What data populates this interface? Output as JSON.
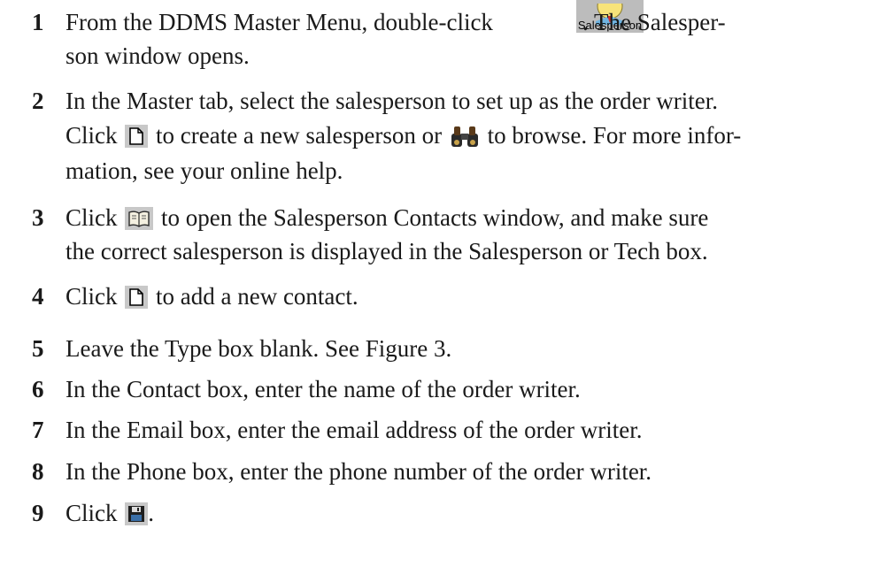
{
  "steps": [
    {
      "number": "1",
      "line1a": "From the DDMS Master Menu, double-click",
      "icon_label": "Salesperson",
      "line1b": ". The Salesper-",
      "line2": "son window opens."
    },
    {
      "number": "2",
      "line1": "In the Master tab, select the salesperson to set up as the order writer.",
      "line2a": "Click",
      "line2b": "to create a new salesperson or",
      "line2c": "to browse. For more infor-",
      "line3": "mation, see your online help."
    },
    {
      "number": "3",
      "line1a": "Click",
      "line1b": "to open the Salesperson Contacts window, and make sure",
      "line2": "the correct salesperson is displayed in the Salesperson or Tech box."
    },
    {
      "number": "4",
      "line1a": "Click",
      "line1b": "to add a new contact."
    },
    {
      "number": "5",
      "text": "Leave the Type box blank. See Figure 3."
    },
    {
      "number": "6",
      "text": "In the Contact box, enter the name of the order writer."
    },
    {
      "number": "7",
      "text": "In the Email box, enter the email address of the order writer."
    },
    {
      "number": "8",
      "text": "In the Phone box, enter the phone number of the order writer."
    },
    {
      "number": "9",
      "line1a": "Click",
      "line1b": "."
    }
  ],
  "icons": {
    "salesperson": "salesperson-icon",
    "new_document": "new-document-icon",
    "binoculars": "binoculars-icon",
    "contacts_book": "contacts-book-icon",
    "save": "save-disk-icon",
    "icon_background": "#c8c8c8"
  }
}
